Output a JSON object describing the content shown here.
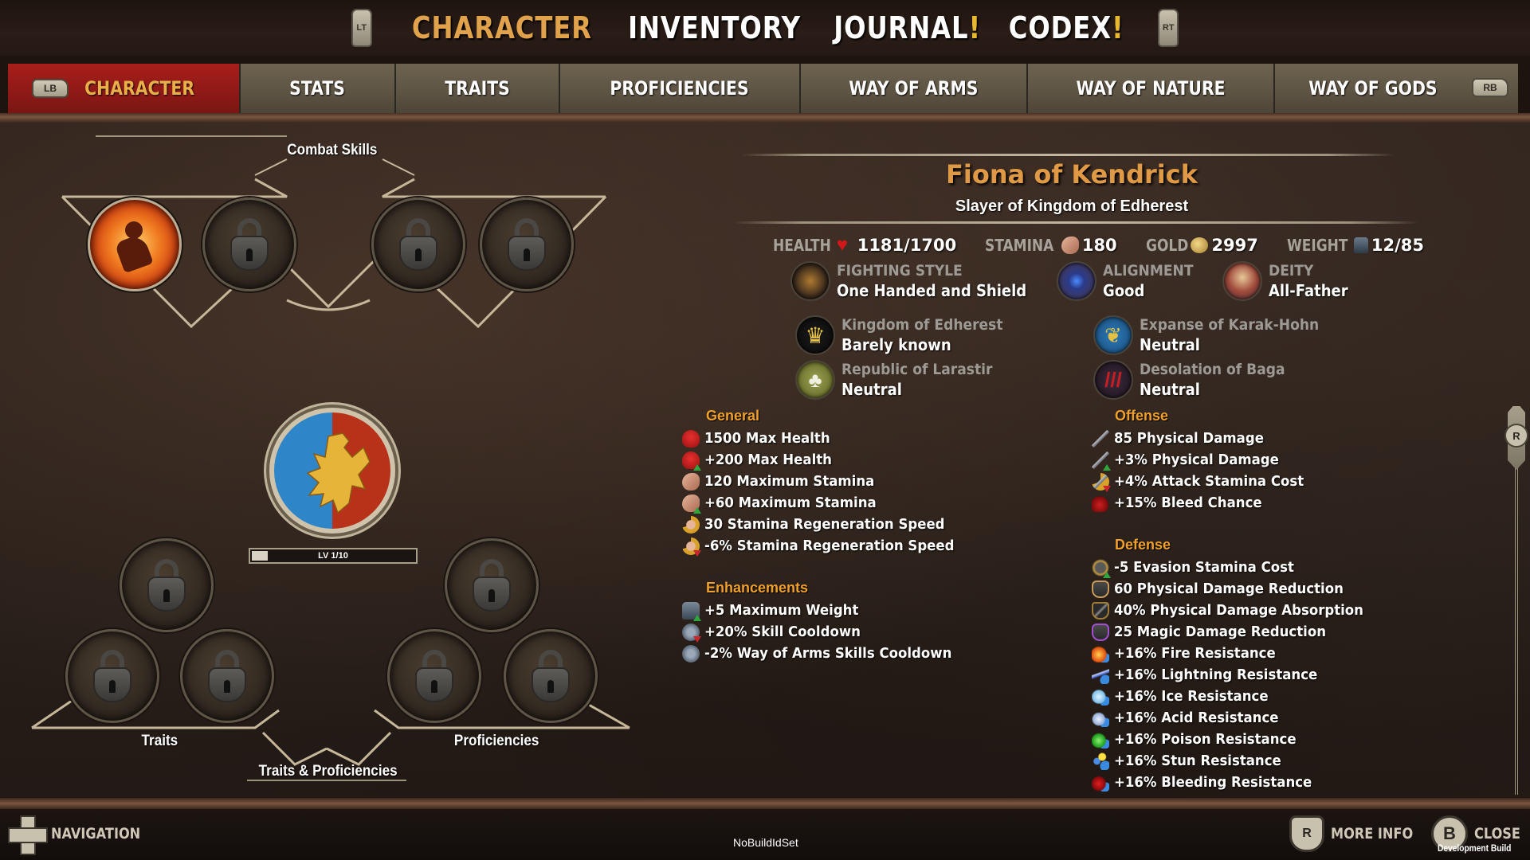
{
  "header": {
    "left_trigger": "LT",
    "right_trigger": "RT",
    "main_tabs": [
      {
        "label": "CHARACTER",
        "active": true,
        "alert": ""
      },
      {
        "label": "INVENTORY",
        "active": false,
        "alert": ""
      },
      {
        "label": "JOURNAL",
        "active": false,
        "alert": "!"
      },
      {
        "label": "CODEX",
        "active": false,
        "alert": "!"
      }
    ]
  },
  "subnav": {
    "left_bumper": "LB",
    "right_bumper": "RB",
    "tabs": [
      {
        "label": "CHARACTER",
        "active": true
      },
      {
        "label": "STATS",
        "active": false
      },
      {
        "label": "TRAITS",
        "active": false
      },
      {
        "label": "PROFICIENCIES",
        "active": false
      },
      {
        "label": "WAY OF ARMS",
        "active": false
      },
      {
        "label": "WAY OF NATURE",
        "active": false
      },
      {
        "label": "WAY OF GODS",
        "active": false
      }
    ]
  },
  "left_panel": {
    "combat_skills_label": "Combat Skills",
    "combat_skills": [
      {
        "state": "unlocked",
        "icon": "charge-skill-icon"
      },
      {
        "state": "locked",
        "icon": "lock-icon"
      },
      {
        "state": "locked",
        "icon": "lock-icon"
      },
      {
        "state": "locked",
        "icon": "lock-icon"
      }
    ],
    "crest_icon": "lion-rampant-crest",
    "level_text": "LV 1/10",
    "level_progress": 0.1,
    "traits_label": "Traits",
    "proficiencies_label": "Proficiencies",
    "traits_and_proficiencies_label": "Traits & Proficiencies",
    "trait_slots": [
      "locked",
      "locked",
      "locked"
    ],
    "proficiency_slots": [
      "locked",
      "locked",
      "locked"
    ]
  },
  "character": {
    "name": "Fiona of Kendrick",
    "title": "Slayer of Kingdom of Edherest",
    "vitals": [
      {
        "key": "HEALTH",
        "icon": "heart-icon",
        "value": "1181/1700"
      },
      {
        "key": "STAMINA",
        "icon": "arm-icon",
        "value": "180"
      },
      {
        "key": "GOLD",
        "icon": "coin-icon",
        "value": "2997"
      },
      {
        "key": "WEIGHT",
        "icon": "weight-icon",
        "value": "12/85"
      }
    ],
    "attributes": [
      {
        "key": "FIGHTING STYLE",
        "value": "One Handed and Shield",
        "icon": "fighting-style-icon"
      },
      {
        "key": "ALIGNMENT",
        "value": "Good",
        "icon": "eye-icon"
      },
      {
        "key": "DEITY",
        "value": "All-Father",
        "icon": "deity-icon"
      }
    ],
    "factions": [
      {
        "name": "Kingdom of Edherest",
        "standing": "Barely known",
        "icon": "crown-icon"
      },
      {
        "name": "Expanse of Karak-Hohn",
        "standing": "Neutral",
        "icon": "griffin-icon"
      },
      {
        "name": "Republic of Larastir",
        "standing": "Neutral",
        "icon": "tree-icon"
      },
      {
        "name": "Desolation of Baga",
        "standing": "Neutral",
        "icon": "claw-icon"
      }
    ]
  },
  "stat_groups": {
    "general": {
      "title": "General",
      "items": [
        {
          "text": "1500 Max Health",
          "icon": "heart-icon",
          "mod": ""
        },
        {
          "text": "+200 Max Health",
          "icon": "heart-icon",
          "mod": "up"
        },
        {
          "text": "120 Maximum Stamina",
          "icon": "arm-icon",
          "mod": ""
        },
        {
          "text": "+60 Maximum Stamina",
          "icon": "arm-icon",
          "mod": "up"
        },
        {
          "text": "30 Stamina Regeneration Speed",
          "icon": "stamina-regen-icon",
          "mod": ""
        },
        {
          "text": "-6% Stamina Regeneration Speed",
          "icon": "stamina-regen-icon",
          "mod": "down"
        }
      ]
    },
    "enhancements": {
      "title": "Enhancements",
      "items": [
        {
          "text": "+5 Maximum Weight",
          "icon": "weight-icon",
          "mod": "up"
        },
        {
          "text": "+20% Skill Cooldown",
          "icon": "hourglass-icon",
          "mod": "down"
        },
        {
          "text": "-2% Way of Arms Skills Cooldown",
          "icon": "hourglass-icon",
          "mod": ""
        }
      ]
    },
    "offense": {
      "title": "Offense",
      "items": [
        {
          "text": "85 Physical Damage",
          "icon": "sword-icon",
          "mod": ""
        },
        {
          "text": "+3% Physical Damage",
          "icon": "sword-icon",
          "mod": "up"
        },
        {
          "text": "+4% Attack Stamina Cost",
          "icon": "attack-stamina-icon",
          "mod": "down"
        },
        {
          "text": "+15% Bleed Chance",
          "icon": "bleed-icon",
          "mod": ""
        }
      ]
    },
    "defense": {
      "title": "Defense",
      "items": [
        {
          "text": "-5 Evasion Stamina Cost",
          "icon": "evasion-icon",
          "mod": "up"
        },
        {
          "text": "60 Physical Damage Reduction",
          "icon": "armor-icon",
          "mod": ""
        },
        {
          "text": "40% Physical Damage Absorption",
          "icon": "absorption-icon",
          "mod": ""
        },
        {
          "text": "25 Magic Damage Reduction",
          "icon": "magic-armor-icon",
          "mod": ""
        },
        {
          "text": "+16% Fire Resistance",
          "icon": "fire-resistance-icon",
          "mod": ""
        },
        {
          "text": "+16% Lightning Resistance",
          "icon": "lightning-resistance-icon",
          "mod": ""
        },
        {
          "text": "+16% Ice Resistance",
          "icon": "ice-resistance-icon",
          "mod": ""
        },
        {
          "text": "+16% Acid Resistance",
          "icon": "acid-resistance-icon",
          "mod": ""
        },
        {
          "text": "+16% Poison Resistance",
          "icon": "poison-resistance-icon",
          "mod": ""
        },
        {
          "text": "+16% Stun Resistance",
          "icon": "stun-resistance-icon",
          "mod": ""
        },
        {
          "text": "+16% Bleeding Resistance",
          "icon": "bleeding-resistance-icon",
          "mod": ""
        }
      ]
    }
  },
  "scrollbar": {
    "button": "R"
  },
  "footer": {
    "navigation_label": "NAVIGATION",
    "more_info_label": "MORE INFO",
    "more_info_button": "R",
    "close_label": "CLOSE",
    "close_button": "B",
    "build_id": "NoBuildIdSet",
    "dev_build": "Development Build"
  },
  "colors": {
    "accent_orange": "#e09a45",
    "group_title": "#f0a02a",
    "active_tab_red": "#8d1916",
    "mod_up": "#2fa63b",
    "mod_down": "#c8262a"
  }
}
